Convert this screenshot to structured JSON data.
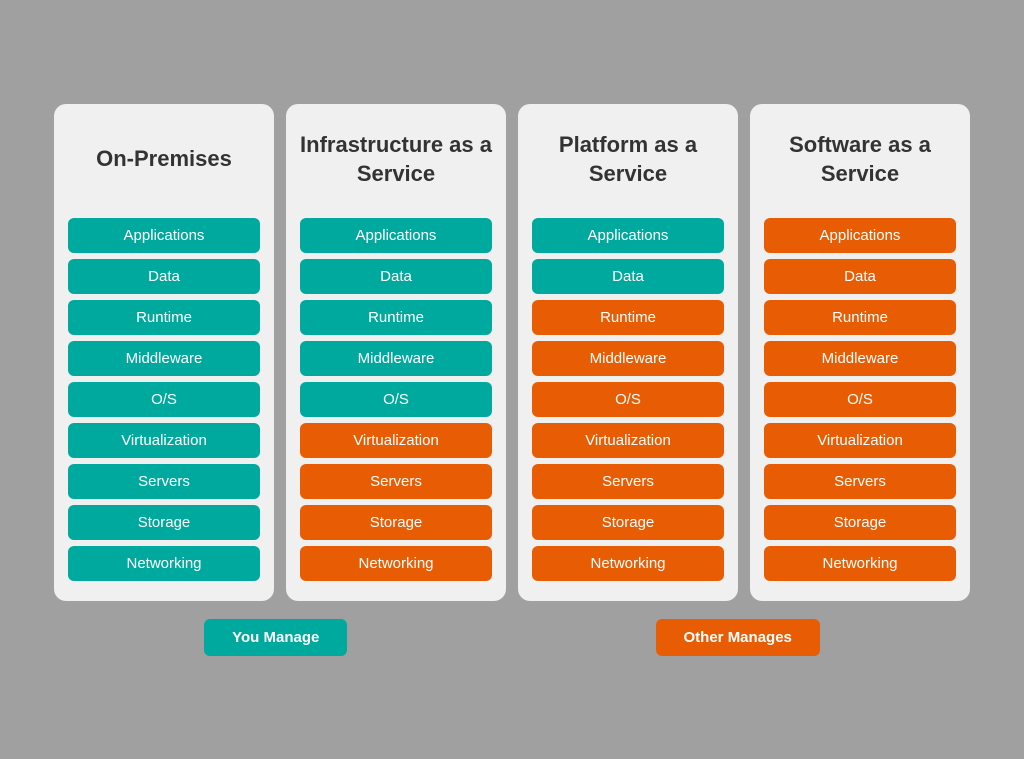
{
  "columns": [
    {
      "id": "on-premises",
      "title": "On-Premises",
      "items": [
        {
          "label": "Applications",
          "color": "teal"
        },
        {
          "label": "Data",
          "color": "teal"
        },
        {
          "label": "Runtime",
          "color": "teal"
        },
        {
          "label": "Middleware",
          "color": "teal"
        },
        {
          "label": "O/S",
          "color": "teal"
        },
        {
          "label": "Virtualization",
          "color": "teal"
        },
        {
          "label": "Servers",
          "color": "teal"
        },
        {
          "label": "Storage",
          "color": "teal"
        },
        {
          "label": "Networking",
          "color": "teal"
        }
      ]
    },
    {
      "id": "iaas",
      "title": "Infrastructure as a Service",
      "items": [
        {
          "label": "Applications",
          "color": "teal"
        },
        {
          "label": "Data",
          "color": "teal"
        },
        {
          "label": "Runtime",
          "color": "teal"
        },
        {
          "label": "Middleware",
          "color": "teal"
        },
        {
          "label": "O/S",
          "color": "teal"
        },
        {
          "label": "Virtualization",
          "color": "orange"
        },
        {
          "label": "Servers",
          "color": "orange"
        },
        {
          "label": "Storage",
          "color": "orange"
        },
        {
          "label": "Networking",
          "color": "orange"
        }
      ]
    },
    {
      "id": "paas",
      "title": "Platform as a Service",
      "items": [
        {
          "label": "Applications",
          "color": "teal"
        },
        {
          "label": "Data",
          "color": "teal"
        },
        {
          "label": "Runtime",
          "color": "orange"
        },
        {
          "label": "Middleware",
          "color": "orange"
        },
        {
          "label": "O/S",
          "color": "orange"
        },
        {
          "label": "Virtualization",
          "color": "orange"
        },
        {
          "label": "Servers",
          "color": "orange"
        },
        {
          "label": "Storage",
          "color": "orange"
        },
        {
          "label": "Networking",
          "color": "orange"
        }
      ]
    },
    {
      "id": "saas",
      "title": "Software as a Service",
      "items": [
        {
          "label": "Applications",
          "color": "orange"
        },
        {
          "label": "Data",
          "color": "orange"
        },
        {
          "label": "Runtime",
          "color": "orange"
        },
        {
          "label": "Middleware",
          "color": "orange"
        },
        {
          "label": "O/S",
          "color": "orange"
        },
        {
          "label": "Virtualization",
          "color": "orange"
        },
        {
          "label": "Servers",
          "color": "orange"
        },
        {
          "label": "Storage",
          "color": "orange"
        },
        {
          "label": "Networking",
          "color": "orange"
        }
      ]
    }
  ],
  "legend": {
    "you_manage": "You Manage",
    "other_manages": "Other Manages",
    "you_manage_color": "#00a99d",
    "other_manages_color": "#e85d04"
  }
}
